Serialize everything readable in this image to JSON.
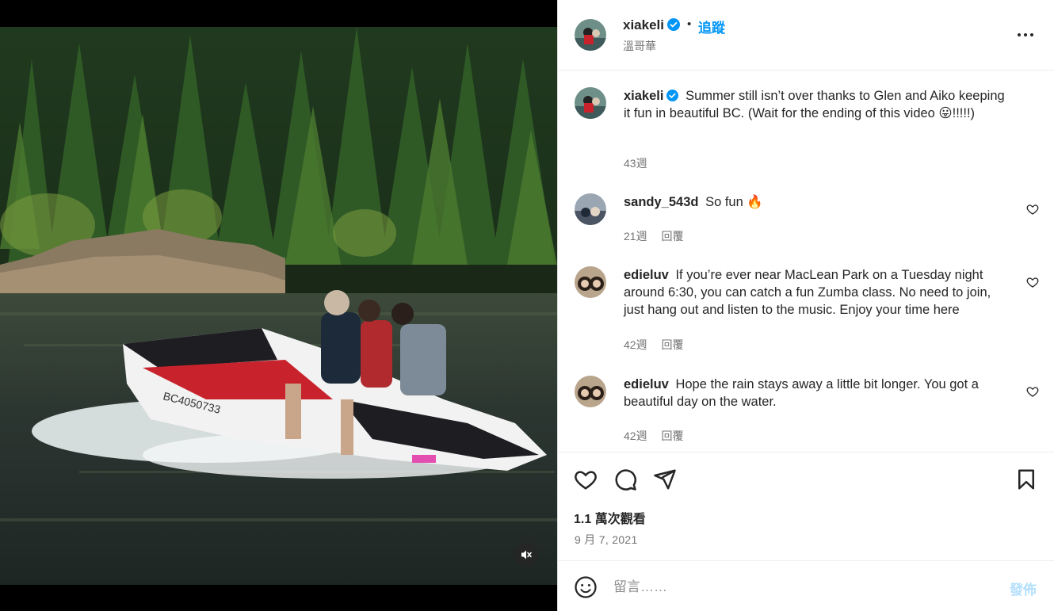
{
  "post": {
    "author": "xiakeli",
    "verified": true,
    "follow_label": "追蹤",
    "separator": "•",
    "location": "溫哥華",
    "video_plate": "BC4050733"
  },
  "caption": {
    "username": "xiakeli",
    "text": "Summer still isn’t over thanks to Glen and Aiko keeping it fun in beautiful BC. (Wait for the ending of this video 😛!!!!!)",
    "time": "43週"
  },
  "comments": [
    {
      "username": "sandy_543d",
      "text": "So fun 🔥",
      "time": "21週",
      "reply_label": "回覆"
    },
    {
      "username": "edieluv",
      "text": "If you’re ever near MacLean Park on a Tuesday night around 6:30, you can catch a fun Zumba class. No need to join, just hang out and listen to the music. Enjoy your time here",
      "time": "42週",
      "reply_label": "回覆"
    },
    {
      "username": "edieluv",
      "text": "Hope the rain stays away a little bit longer. You got a beautiful day on the water.",
      "time": "42週",
      "reply_label": "回覆"
    }
  ],
  "stats": {
    "views": "1.1 萬次觀看",
    "date": "9 月 7, 2021"
  },
  "composer": {
    "placeholder": "留言……",
    "post_label": "發佈"
  },
  "icons": {
    "more": "more-options-icon",
    "like": "heart-icon",
    "comment": "comment-icon",
    "share": "send-icon",
    "save": "bookmark-icon",
    "emoji": "emoji-icon",
    "mute": "muted-speaker-icon"
  },
  "colors": {
    "link_blue": "#0095f6",
    "post_disabled": "#b2dffc",
    "secondary_text": "#737373"
  }
}
